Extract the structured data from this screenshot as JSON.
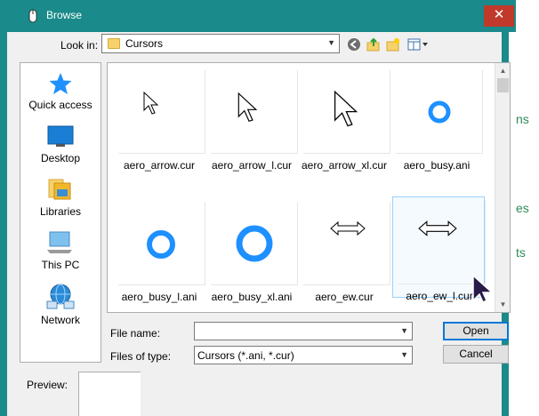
{
  "window": {
    "title": "Browse",
    "close_glyph": "✕"
  },
  "toolbar": {
    "look_in_label": "Look in:",
    "look_in_value": "Cursors",
    "icons": [
      "back-icon",
      "up-folder-icon",
      "new-folder-icon",
      "view-menu-icon"
    ]
  },
  "places": [
    {
      "label": "Quick access",
      "icon": "star-icon"
    },
    {
      "label": "Desktop",
      "icon": "desktop-icon"
    },
    {
      "label": "Libraries",
      "icon": "libraries-icon"
    },
    {
      "label": "This PC",
      "icon": "computer-icon"
    },
    {
      "label": "Network",
      "icon": "network-icon"
    }
  ],
  "files": [
    {
      "name": "aero_arrow.cur",
      "kind": "arrow-small"
    },
    {
      "name": "aero_arrow_l.cur",
      "kind": "arrow-medium"
    },
    {
      "name": "aero_arrow_xl.cur",
      "kind": "arrow-large"
    },
    {
      "name": "aero_busy.ani",
      "kind": "busy-small"
    },
    {
      "name": "aero_busy_l.ani",
      "kind": "busy-medium"
    },
    {
      "name": "aero_busy_xl.ani",
      "kind": "busy-large"
    },
    {
      "name": "aero_ew.cur",
      "kind": "ew"
    },
    {
      "name": "aero_ew_l.cur",
      "kind": "ew-large",
      "selected": true
    }
  ],
  "form": {
    "file_name_label": "File name:",
    "file_name_value": "",
    "files_of_type_label": "Files of type:",
    "files_of_type_value": "Cursors (*.ani, *.cur)",
    "open_label": "Open",
    "cancel_label": "Cancel"
  },
  "preview": {
    "label": "Preview:"
  },
  "background_fragments": [
    "ns",
    "es",
    "ts"
  ],
  "colors": {
    "titlebar": "#1a8a8a",
    "close": "#c0392b",
    "busy_ring": "#1e90ff"
  }
}
